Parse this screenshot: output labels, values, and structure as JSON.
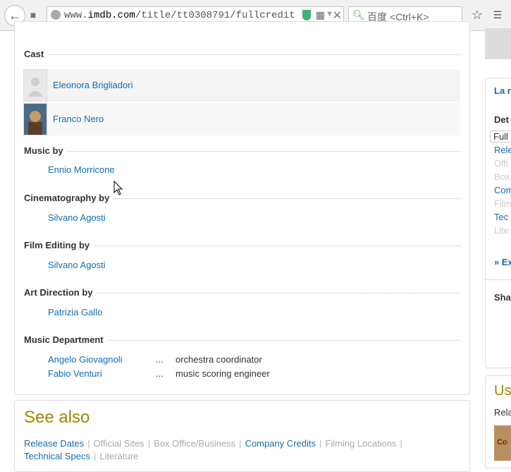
{
  "browser": {
    "url_prefix": "www.",
    "url_domain": "imdb.com",
    "url_path": "/title/tt0308791/fullcredit",
    "search_placeholder": "百度 <Ctrl+K>"
  },
  "cast": {
    "heading": "Cast",
    "members": [
      {
        "name": "Eleonora Brigliadori",
        "thumb": "placeholder"
      },
      {
        "name": "Franco Nero",
        "thumb": "photo"
      }
    ]
  },
  "sections": [
    {
      "heading": "Music by",
      "people": [
        {
          "name": "Ennio Morricone"
        }
      ]
    },
    {
      "heading": "Cinematography by",
      "people": [
        {
          "name": "Silvano Agosti"
        }
      ]
    },
    {
      "heading": "Film Editing by",
      "people": [
        {
          "name": "Silvano Agosti"
        }
      ]
    },
    {
      "heading": "Art Direction by",
      "people": [
        {
          "name": "Patrizia Gallo"
        }
      ]
    },
    {
      "heading": "Music Department",
      "people": [
        {
          "name": "Angelo Giovagnoli",
          "dots": "...",
          "role": "orchestra coordinator"
        },
        {
          "name": "Fabio Venturi",
          "dots": "...",
          "role": "music scoring engineer"
        }
      ]
    }
  ],
  "see_also": {
    "title": "See also",
    "links": [
      {
        "label": "Release Dates",
        "active": true
      },
      {
        "label": "Official Sites",
        "active": false
      },
      {
        "label": "Box Office/Business",
        "active": false
      },
      {
        "label": "Company Credits",
        "active": true
      },
      {
        "label": "Filming Locations",
        "active": false
      },
      {
        "label": "Technical Specs",
        "active": true
      },
      {
        "label": "Literature",
        "active": false
      }
    ]
  },
  "sidebar": {
    "title_fragment": "La r",
    "details_fragment": "Det",
    "items": [
      {
        "label": "Full",
        "state": "selected"
      },
      {
        "label": "Rele",
        "state": "link"
      },
      {
        "label": "Offi",
        "state": "disabled"
      },
      {
        "label": "Box",
        "state": "disabled"
      },
      {
        "label": "Com",
        "state": "link"
      },
      {
        "label": "Film",
        "state": "disabled"
      },
      {
        "label": "Tec",
        "state": "link"
      },
      {
        "label": "Lite",
        "state": "disabled"
      }
    ],
    "explore_fragment": "Ex",
    "share_fragment": "Sha",
    "user_lists_fragment": "Us",
    "related_fragment": "Rela",
    "poster_text": "Co"
  },
  "colors": {
    "link": "#136cb2",
    "see_also_title": "#a58500",
    "disabled": "#aaaaaa"
  }
}
